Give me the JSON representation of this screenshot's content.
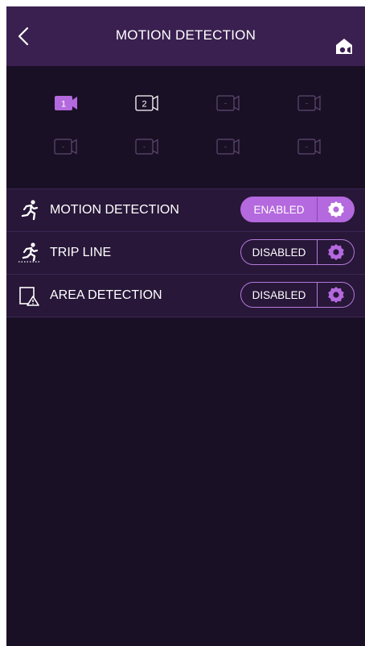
{
  "header": {
    "title": "MOTION DETECTION"
  },
  "cameras": [
    {
      "label": "1",
      "state": "selected"
    },
    {
      "label": "2",
      "state": "available"
    },
    {
      "label": "-",
      "state": "empty"
    },
    {
      "label": "-",
      "state": "empty"
    },
    {
      "label": "-",
      "state": "empty"
    },
    {
      "label": "-",
      "state": "empty"
    },
    {
      "label": "-",
      "state": "empty"
    },
    {
      "label": "-",
      "state": "empty"
    }
  ],
  "detections": [
    {
      "icon": "running-person-icon",
      "label": "MOTION DETECTION",
      "status": "ENABLED"
    },
    {
      "icon": "trip-line-icon",
      "label": "TRIP LINE",
      "status": "DISABLED"
    },
    {
      "icon": "area-warning-icon",
      "label": "AREA DETECTION",
      "status": "DISABLED"
    }
  ],
  "colors": {
    "background": "#1a1026",
    "header": "#3a2050",
    "accent": "#b469de",
    "row": "#281739"
  }
}
